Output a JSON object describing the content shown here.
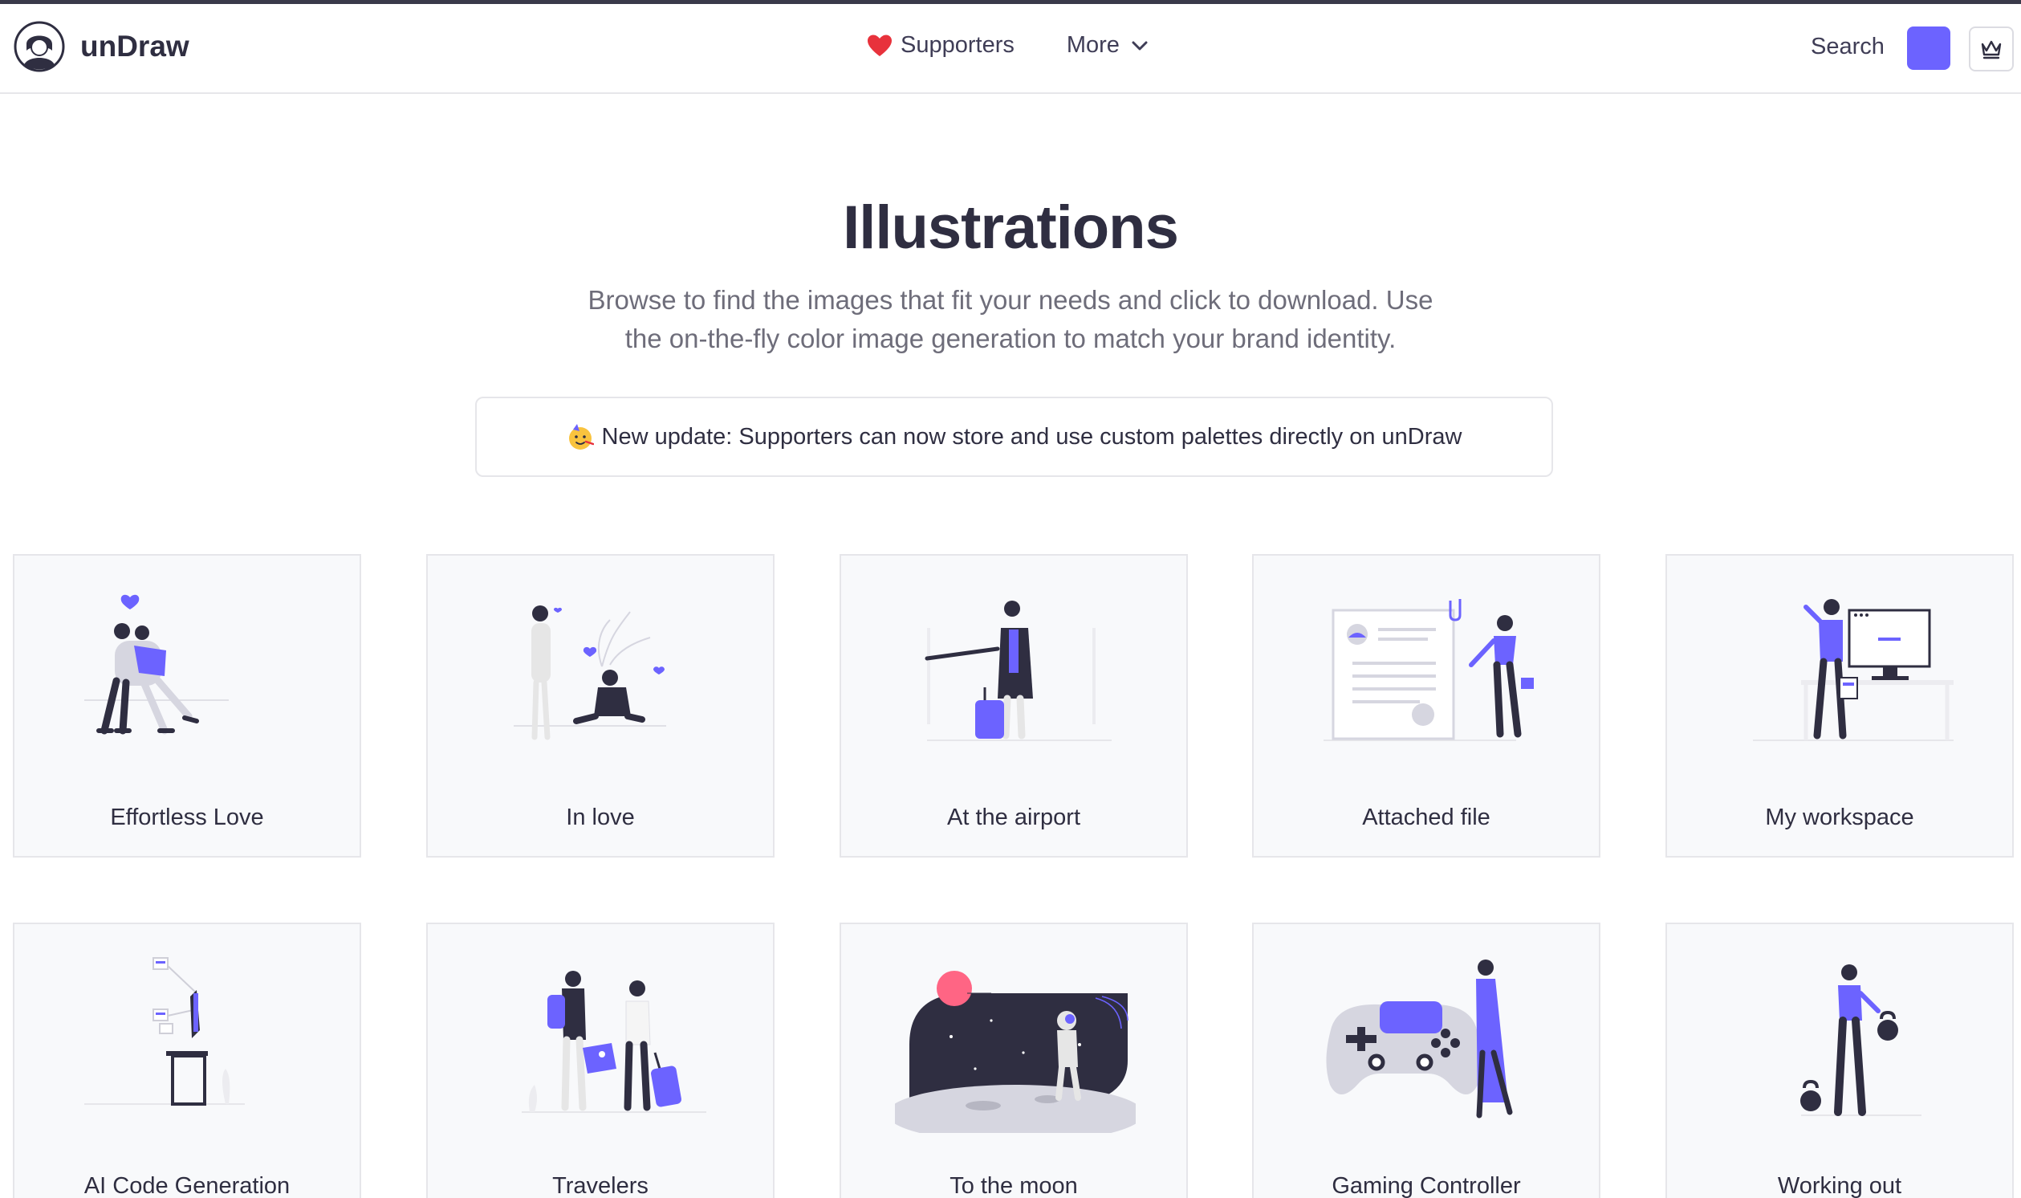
{
  "app": {
    "name": "unDraw"
  },
  "nav": {
    "supporters": "Supporters",
    "more": "More",
    "search": "Search"
  },
  "colors": {
    "accent": "#6c63ff",
    "dark": "#2f2e41",
    "heart": "#e8323c"
  },
  "hero": {
    "title": "Illustrations",
    "subtitle": "Browse to find the images that fit your needs and click to download. Use the on-the-fly color image generation to match your brand identity."
  },
  "banner": {
    "text": "New update: Supporters can now store and use custom palettes directly on unDraw"
  },
  "illustrations": [
    {
      "label": "Effortless Love"
    },
    {
      "label": "In love"
    },
    {
      "label": "At the airport"
    },
    {
      "label": "Attached file"
    },
    {
      "label": "My workspace"
    },
    {
      "label": "AI Code Generation"
    },
    {
      "label": "Travelers"
    },
    {
      "label": "To the moon"
    },
    {
      "label": "Gaming Controller"
    },
    {
      "label": "Working out"
    }
  ]
}
